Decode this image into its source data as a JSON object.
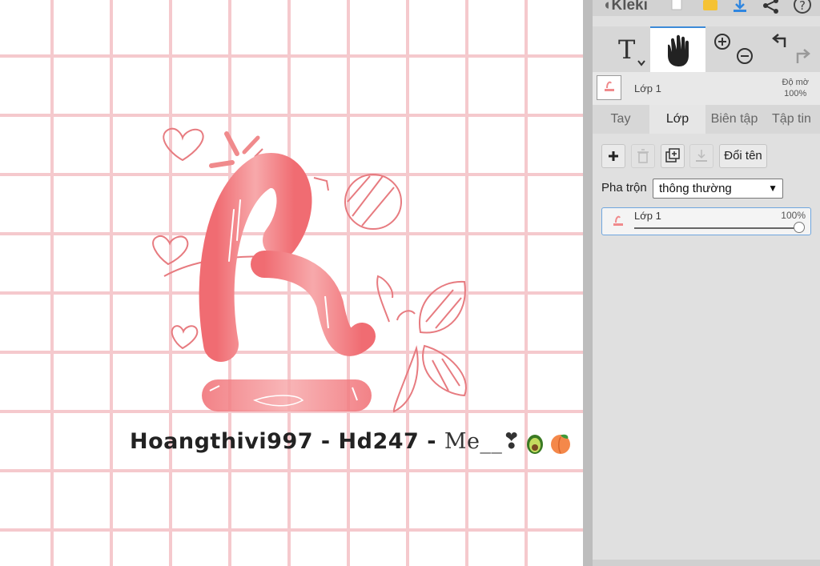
{
  "app": {
    "name": "Kleki"
  },
  "toolbar": {
    "icons": [
      "new-image-icon",
      "open-folder-icon",
      "download-icon",
      "share-icon",
      "help-icon"
    ],
    "tools": [
      "text-tool-icon",
      "hand-tool-icon",
      "zoom-in-icon",
      "zoom-out-icon",
      "undo-icon",
      "redo-icon"
    ]
  },
  "layer_header": {
    "name": "Lớp 1",
    "opacity_label": "Độ mờ",
    "opacity_value": "100%"
  },
  "tabs": [
    {
      "label": "Tay",
      "active": false
    },
    {
      "label": "Lớp",
      "active": true
    },
    {
      "label": "Biên tập",
      "active": false
    },
    {
      "label": "Tập tin",
      "active": false
    }
  ],
  "layer_actions": {
    "rename_label": "Đổi tên"
  },
  "blend": {
    "label": "Pha trộn",
    "selected": "thông thường"
  },
  "layers": [
    {
      "name": "Lớp 1",
      "opacity_text": "100%",
      "opacity": 1.0
    }
  ],
  "canvas": {
    "caption_main": "Hoangthivi997 - Hd247 - ",
    "caption_me": "Me__❣",
    "colors": {
      "grid": "#f5c9cd",
      "letter": "#f08a8c",
      "outline": "#e77b80"
    }
  },
  "accent": "#3c8ad8"
}
